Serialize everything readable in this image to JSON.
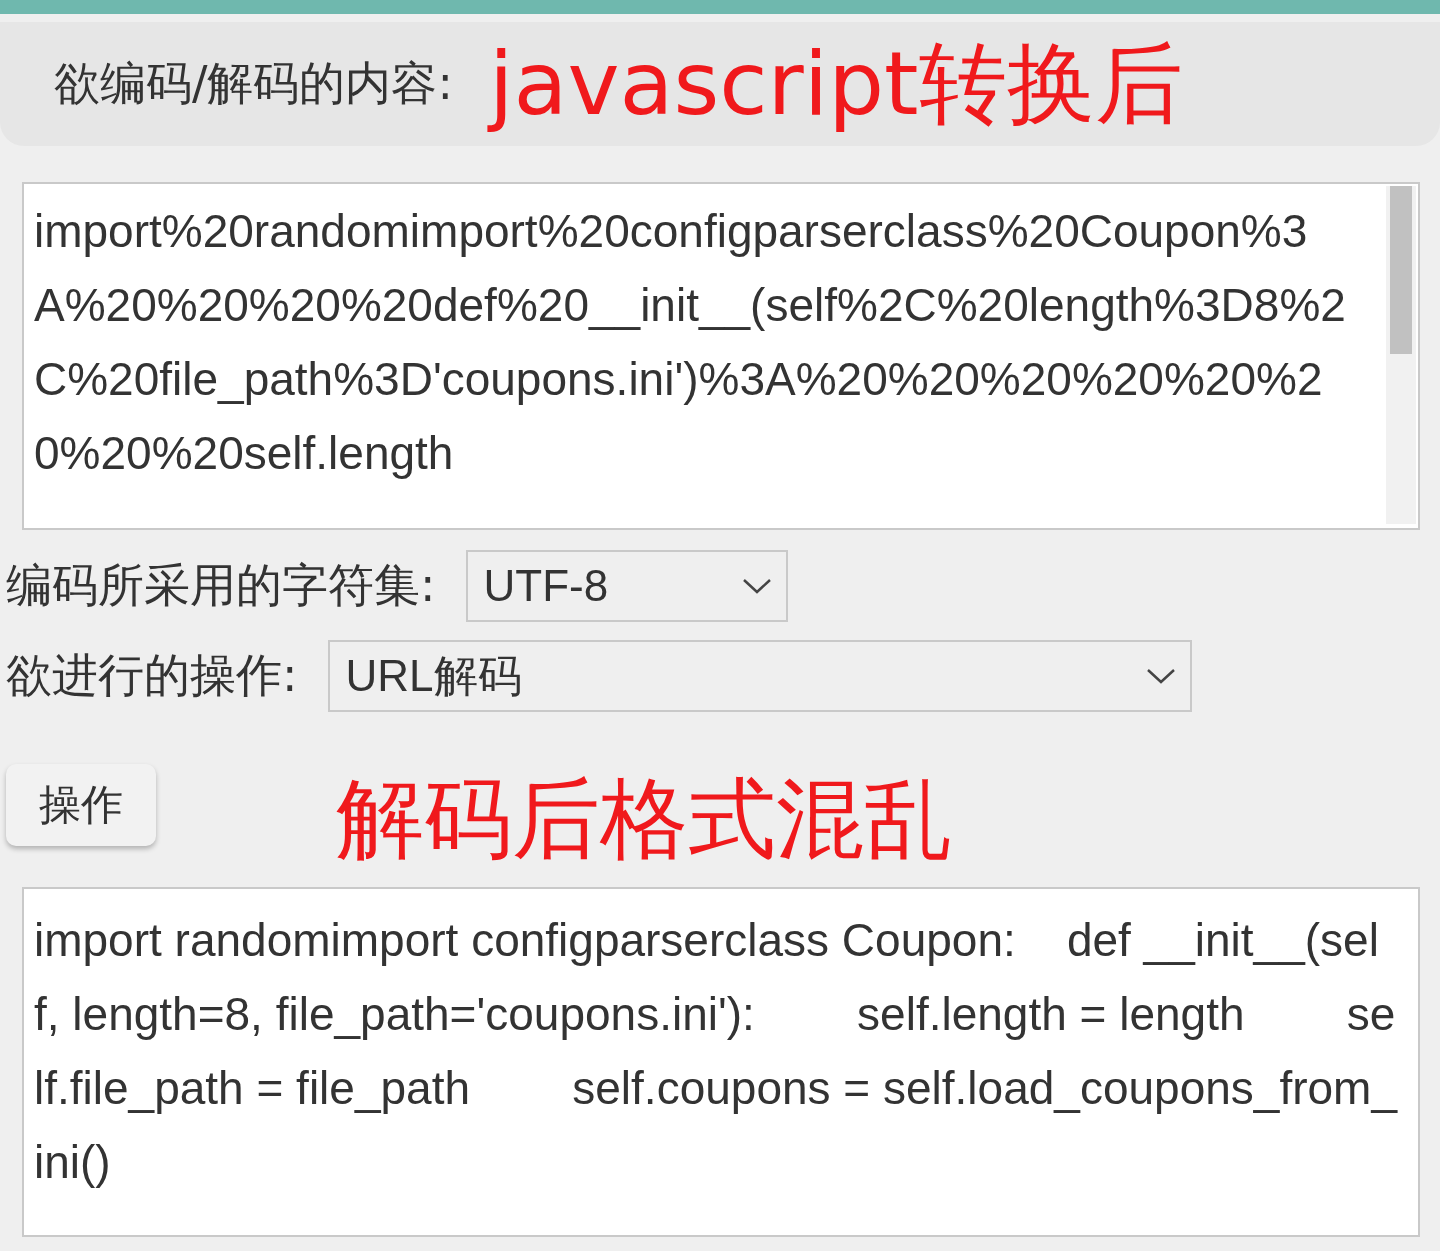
{
  "input_section": {
    "label": "欲编码/解码的内容:",
    "annotation": "javascript转换后"
  },
  "input_box": {
    "value": "import%20randomimport%20configparserclass%20Coupon%3A%20%20%20%20def%20__init__(self%2C%20length%3D8%2C%20file_path%3D'coupons.ini')%3A%20%20%20%20%20%20%20%20self.length"
  },
  "charset": {
    "label": "编码所采用的字符集:",
    "value": "UTF-8"
  },
  "operation": {
    "label": "欲进行的操作:",
    "value": "URL解码"
  },
  "action_button": {
    "label": "操作"
  },
  "result_annotation": "解码后格式混乱",
  "output_box": {
    "value": "import randomimport configparserclass Coupon:    def __init__(self, length=8, file_path='coupons.ini'):        self.length = length        self.file_path = file_path        self.coupons = self.load_coupons_from_ini()"
  }
}
